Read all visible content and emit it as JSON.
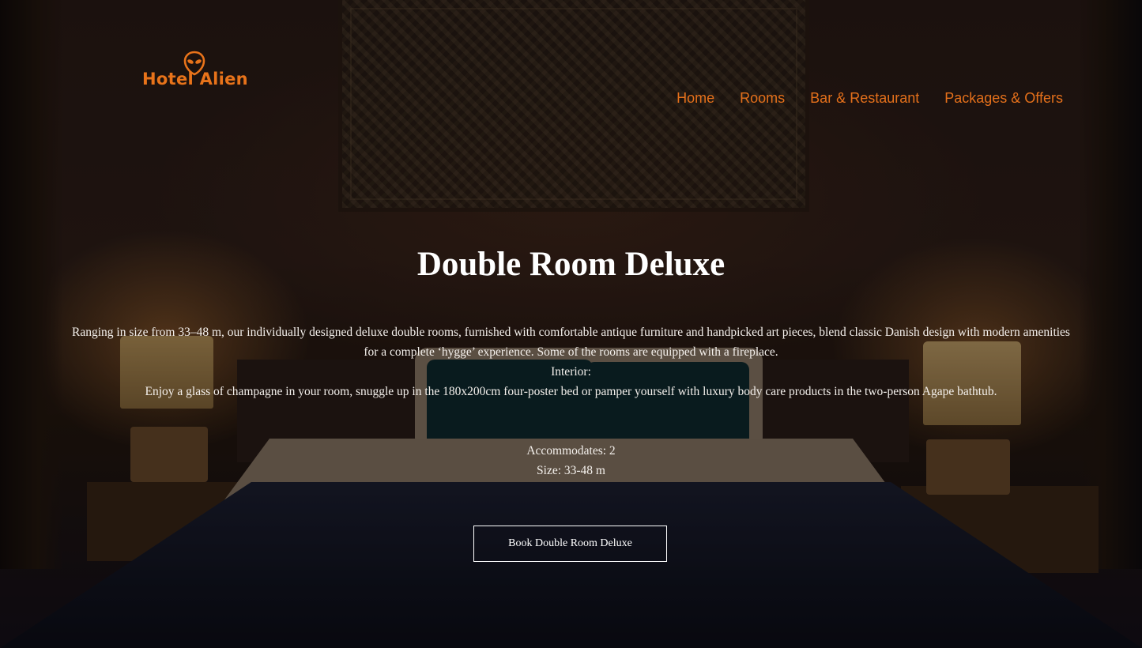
{
  "header": {
    "logo_text": "Hotel Alien",
    "logo_icon": "alien-head-icon",
    "nav": [
      {
        "label": "Home"
      },
      {
        "label": "Rooms"
      },
      {
        "label": "Bar & Restaurant"
      },
      {
        "label": "Packages & Offers"
      }
    ]
  },
  "room": {
    "title": "Double Room Deluxe",
    "description": "Ranging in size from 33–48 m, our individually designed deluxe double rooms, furnished with comfortable antique furniture and handpicked art pieces, blend classic Danish design with modern amenities for a complete ‘hygge’ experience. Some of the rooms are equipped with a fireplace.",
    "interior_label": "Interior:",
    "interior_text": "Enjoy a glass of champagne in your room, snuggle up in the 180x200cm four-poster bed or pamper yourself with luxury body care products in the two-person Agape bathtub.",
    "accommodates": "Accommodates: 2",
    "size": "Size: 33-48 m",
    "book_button": "Book Double Room Deluxe"
  },
  "colors": {
    "accent": "#e4701b",
    "text": "#ffffff"
  }
}
